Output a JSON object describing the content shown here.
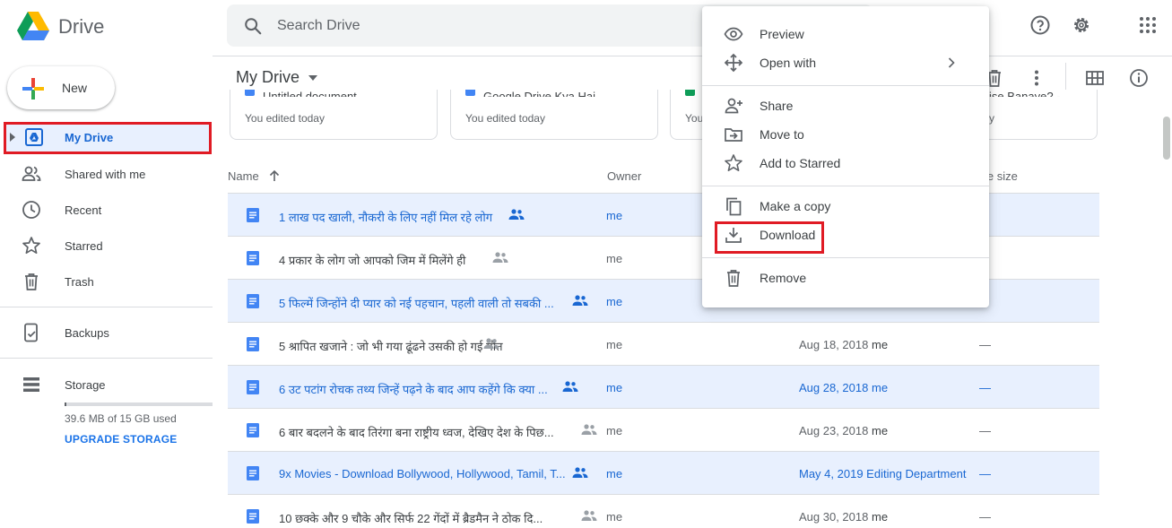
{
  "app": {
    "title": "Drive"
  },
  "search": {
    "placeholder": "Search Drive"
  },
  "sidebar": {
    "new_label": "New",
    "items": [
      {
        "label": "My Drive",
        "icon": "my-drive-icon",
        "active": true
      },
      {
        "label": "Shared with me",
        "icon": "shared-icon"
      },
      {
        "label": "Recent",
        "icon": "clock-icon"
      },
      {
        "label": "Starred",
        "icon": "star-icon"
      },
      {
        "label": "Trash",
        "icon": "trash-icon"
      },
      {
        "label": "Backups",
        "icon": "backup-icon"
      },
      {
        "label": "Storage",
        "icon": "storage-icon"
      }
    ],
    "storage": {
      "used_text": "39.6 MB of 15 GB used",
      "used_fraction": 0.003,
      "upgrade_label": "UPGRADE STORAGE"
    }
  },
  "main": {
    "title": "My Drive",
    "quick_access": [
      {
        "name": "Untitled document",
        "meta": "You edited today",
        "color": "#4285f4"
      },
      {
        "name": "Google Drive Kya Hai",
        "meta": "You edited today",
        "color": "#4285f4"
      },
      {
        "name": "",
        "meta": "You",
        "color": "#0f9d58"
      },
      {
        "name": "ise Banaye? - ...",
        "meta": "y",
        "color": "#4285f4"
      }
    ],
    "columns": {
      "name": "Name",
      "owner": "Owner",
      "size": "le size"
    },
    "files": [
      {
        "name": "1 लाख पद खाली, नौकरी के लिए नहीं मिल रहे लोग",
        "owner": "me",
        "date": "",
        "by": "",
        "size": "",
        "selected": true
      },
      {
        "name": "4 प्रकार के लोग जो आपको जिम में मिलेंगे ही",
        "owner": "me",
        "date": "",
        "by": "",
        "size": "",
        "selected": false
      },
      {
        "name": "5 फिल्में जिन्होंने दी प्यार को नई पहचान, पहली वाली तो सबकी ...",
        "owner": "me",
        "date": "",
        "by": "",
        "size": "",
        "selected": true
      },
      {
        "name": "5 श्रापित खजाने : जो भी गया ढूंढने उसकी हो गई मौत",
        "owner": "me",
        "date": "Aug 18, 2018",
        "by": "me",
        "size": "—",
        "selected": false
      },
      {
        "name": "6 उट पटांग रोचक तथ्य जिन्हें पढ़ने के बाद आप कहेंगे कि क्या ...",
        "owner": "me",
        "date": "Aug 28, 2018",
        "by": "me",
        "size": "—",
        "selected": true
      },
      {
        "name": "6 बार बदलने के बाद तिरंगा बना राष्ट्रीय ध्वज, देखिए देश के पिछ...",
        "owner": "me",
        "date": "Aug 23, 2018",
        "by": "me",
        "size": "—",
        "selected": false
      },
      {
        "name": "9x Movies - Download Bollywood, Hollywood, Tamil, T...",
        "owner": "me",
        "date": "May 4, 2019",
        "by": "Editing Department",
        "size": "—",
        "selected": true
      },
      {
        "name": "10 छक्के और 9 चौके और सिर्फ 22 गेंदों में ब्रैडमैन ने ठोक दि...",
        "owner": "me",
        "date": "Aug 30, 2018",
        "by": "me",
        "size": "—",
        "selected": false
      }
    ]
  },
  "context_menu": {
    "items": [
      {
        "label": "Preview",
        "icon": "eye-icon"
      },
      {
        "label": "Open with",
        "icon": "move-arrows-icon"
      },
      {
        "label": "Share",
        "icon": "add-person-icon"
      },
      {
        "label": "Move to",
        "icon": "folder-move-icon"
      },
      {
        "label": "Add to Starred",
        "icon": "star-icon"
      },
      {
        "label": "Make a copy",
        "icon": "copy-icon"
      },
      {
        "label": "Download",
        "icon": "download-icon"
      },
      {
        "label": "Remove",
        "icon": "trash-icon"
      }
    ]
  },
  "colors": {
    "accent": "#1a73e8",
    "selected_bg": "#e8f0fe",
    "highlight_red": "#e01b24"
  }
}
